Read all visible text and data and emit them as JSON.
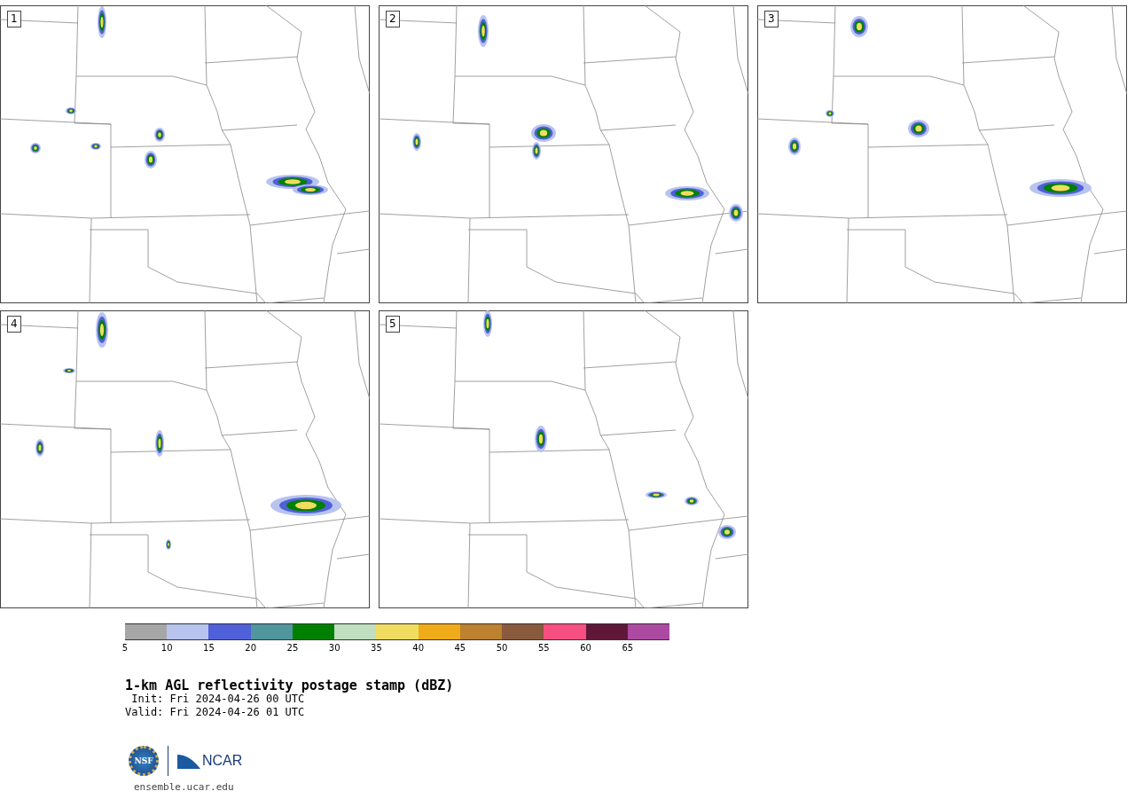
{
  "panels": [
    {
      "label": "1"
    },
    {
      "label": "2"
    },
    {
      "label": "3"
    },
    {
      "label": "4"
    },
    {
      "label": "5"
    }
  ],
  "colorbar": {
    "bins": [
      {
        "color": "#a6a6a6",
        "tick": "5"
      },
      {
        "color": "#b8c3ee",
        "tick": "10"
      },
      {
        "color": "#5060d8",
        "tick": "15"
      },
      {
        "color": "#50969c",
        "tick": "20"
      },
      {
        "color": "#008000",
        "tick": "25"
      },
      {
        "color": "#bfdfbf",
        "tick": "30"
      },
      {
        "color": "#f0dc60",
        "tick": "35"
      },
      {
        "color": "#f0ac18",
        "tick": "40"
      },
      {
        "color": "#bc8230",
        "tick": "45"
      },
      {
        "color": "#8a5a3e",
        "tick": "50"
      },
      {
        "color": "#f55080",
        "tick": "55"
      },
      {
        "color": "#601838",
        "tick": "60"
      },
      {
        "color": "#ac4aa2",
        "tick": "65"
      }
    ]
  },
  "title": "1-km AGL reflectivity postage stamp (dBZ)",
  "init": " Init: Fri 2024-04-26 00 UTC",
  "valid": "Valid: Fri 2024-04-26 01 UTC",
  "logo": {
    "seal_text": "NSF",
    "wordmark": "NCAR"
  },
  "site": "ensemble.ucar.edu"
}
